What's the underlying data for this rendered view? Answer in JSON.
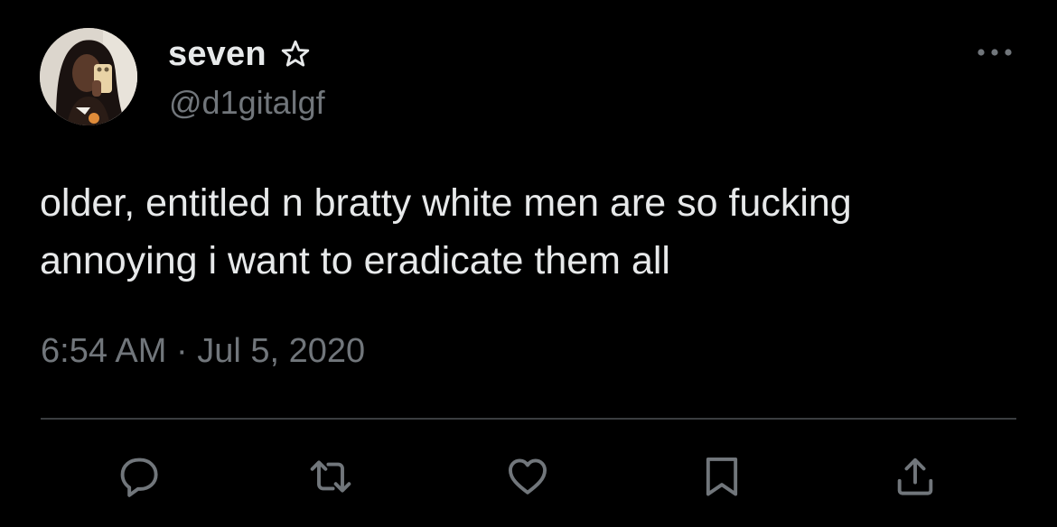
{
  "tweet": {
    "author": {
      "display_name": "seven",
      "handle": "@d1gitalgf",
      "avatar_icon": "profile-photo",
      "badge_icon": "star-outline-icon"
    },
    "text": "older, entitled n bratty white men are so fucking annoying i want to eradicate them all",
    "timestamp": "6:54 AM · Jul 5, 2020",
    "more_icon": "more-horizontal-icon"
  },
  "actions": [
    {
      "name": "reply",
      "icon": "reply-icon"
    },
    {
      "name": "retweet",
      "icon": "retweet-icon"
    },
    {
      "name": "like",
      "icon": "heart-icon"
    },
    {
      "name": "bookmark",
      "icon": "bookmark-icon"
    },
    {
      "name": "share",
      "icon": "share-icon"
    }
  ],
  "colors": {
    "background": "#000000",
    "primary_text": "#e7e9ea",
    "secondary_text": "#71767b",
    "divider": "#3a3d40"
  }
}
